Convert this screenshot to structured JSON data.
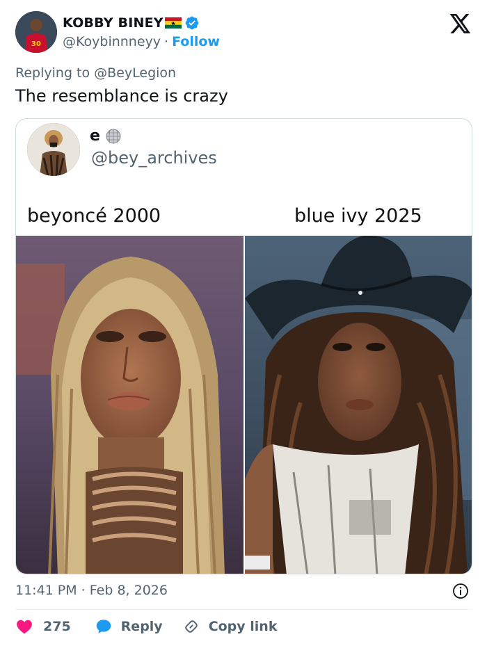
{
  "author": {
    "display_name": "KOBBY BINEY",
    "handle": "@Koybinnneyy",
    "separator": "·",
    "follow_label": "Follow"
  },
  "reply_context": {
    "prefix": "Replying to",
    "mention": "@BeyLegion"
  },
  "tweet": {
    "text": "The resemblance is crazy",
    "time": "11:41 PM · Feb 8, 2026"
  },
  "quote": {
    "display_name": "e",
    "handle": "@bey_archives",
    "caption_left": "beyoncé 2000",
    "caption_right": "blue ivy 2025"
  },
  "actions": {
    "like_count": "275",
    "reply_label": "Reply",
    "copy_label": "Copy link"
  },
  "colors": {
    "accent": "#1d9bf0",
    "like": "#f91880",
    "muted": "#536471",
    "text": "#0f1419"
  },
  "icons": [
    "verified-badge-icon",
    "ghana-flag-icon",
    "x-logo-icon",
    "disco-ball-icon",
    "info-icon",
    "heart-icon",
    "reply-bubble-icon",
    "link-icon"
  ]
}
